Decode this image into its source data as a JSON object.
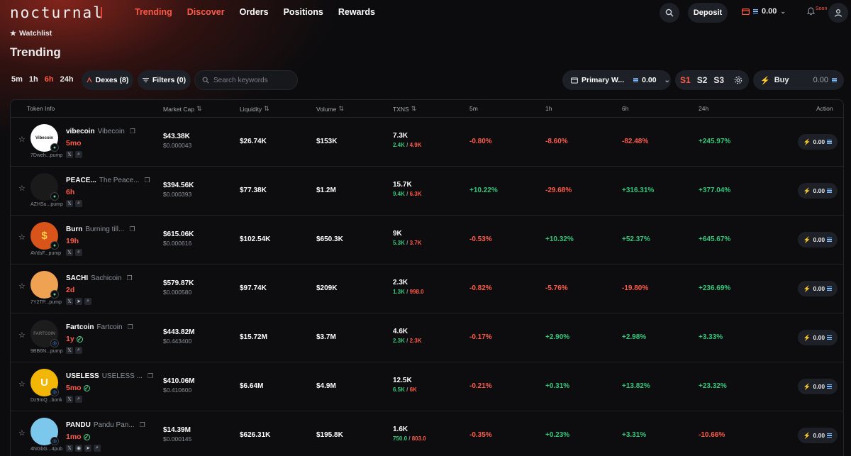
{
  "brand": {
    "logo": "nocturnal"
  },
  "nav": {
    "items": [
      "Trending",
      "Discover",
      "Orders",
      "Positions",
      "Rewards"
    ],
    "active": "Trending"
  },
  "header": {
    "deposit_label": "Deposit",
    "balance": "0.00",
    "soon_badge": "Soon"
  },
  "watchlist_label": "Watchlist",
  "page_title": "Trending",
  "timeframes": {
    "items": [
      "5m",
      "1h",
      "6h",
      "24h"
    ],
    "active": "6h"
  },
  "toolbar": {
    "dexes_label": "Dexes (8)",
    "filters_label": "Filters (0)",
    "search_placeholder": "Search keywords",
    "wallet_label": "Primary W...",
    "wallet_balance": "0.00",
    "presets": [
      "S1",
      "S2",
      "S3"
    ],
    "active_preset": "S1",
    "buy_label": "Buy",
    "buy_amount": "0.00"
  },
  "table": {
    "columns": {
      "token": "Token Info",
      "mcap": "Market Cap",
      "liq": "Liquidity",
      "vol": "Volume",
      "txns": "TXNS",
      "p5m": "5m",
      "p1h": "1h",
      "p6h": "6h",
      "p24h": "24h",
      "action": "Action"
    },
    "rows": [
      {
        "symbol": "vibecoin",
        "name": "Vibecoin",
        "age": "5mo",
        "address": "7Dweh...pump",
        "verified": false,
        "socials": [
          "x-icon",
          "search-icon"
        ],
        "avatar_text": "Vibecoin",
        "avatar_color": "#ffffff",
        "avatar_fg": "#111111",
        "mcap": "$43.38K",
        "price": "$0.000043",
        "liq": "$26.74K",
        "vol": "$153K",
        "txns": "7.3K",
        "buys": "2.4K",
        "sells": "4.9K",
        "p5m": "-0.80%",
        "p1h": "-8.60%",
        "p6h": "-82.48%",
        "p24h": "+245.97%",
        "quick_buy": "0.00"
      },
      {
        "symbol": "PEACE...",
        "name": "The Peace...",
        "age": "6h",
        "address": "AZHSu...pump",
        "verified": false,
        "socials": [
          "x-icon",
          "search-icon"
        ],
        "avatar_text": "",
        "avatar_color": "#1a1a1a",
        "avatar_fg": "#ffffff",
        "mcap": "$394.56K",
        "price": "$0.000393",
        "liq": "$77.38K",
        "vol": "$1.2M",
        "txns": "15.7K",
        "buys": "9.4K",
        "sells": "6.3K",
        "p5m": "+10.22%",
        "p1h": "-29.68%",
        "p6h": "+316.31%",
        "p24h": "+377.04%",
        "quick_buy": "0.00"
      },
      {
        "symbol": "Burn",
        "name": "Burning till...",
        "age": "19h",
        "address": "AVdsF...pump",
        "verified": false,
        "socials": [
          "x-icon",
          "search-icon"
        ],
        "avatar_text": "$",
        "avatar_color": "#d9541a",
        "avatar_fg": "#ffd24a",
        "mcap": "$615.06K",
        "price": "$0.000616",
        "liq": "$102.54K",
        "vol": "$650.3K",
        "txns": "9K",
        "buys": "5.3K",
        "sells": "3.7K",
        "p5m": "-0.53%",
        "p1h": "+10.32%",
        "p6h": "+52.37%",
        "p24h": "+645.67%",
        "quick_buy": "0.00"
      },
      {
        "symbol": "SACHI",
        "name": "Sachicoin",
        "age": "2d",
        "address": "7Y2TP...pump",
        "verified": false,
        "socials": [
          "x-icon",
          "telegram-icon",
          "search-icon"
        ],
        "avatar_text": "",
        "avatar_color": "#f0a253",
        "avatar_fg": "#ffffff",
        "mcap": "$579.87K",
        "price": "$0.000580",
        "liq": "$97.74K",
        "vol": "$209K",
        "txns": "2.3K",
        "buys": "1.3K",
        "sells": "998.0",
        "p5m": "-0.82%",
        "p1h": "-5.76%",
        "p6h": "-19.80%",
        "p24h": "+236.69%",
        "quick_buy": "0.00"
      },
      {
        "symbol": "Fartcoin",
        "name": "Fartcoin",
        "age": "1y",
        "address": "9BB6N...pump",
        "verified": true,
        "socials": [
          "x-icon",
          "search-icon"
        ],
        "avatar_text": "FARTCOIN",
        "avatar_color": "#1c1c1c",
        "avatar_fg": "#666666",
        "mcap": "$443.82M",
        "price": "$0.443400",
        "liq": "$15.72M",
        "vol": "$3.7M",
        "txns": "4.6K",
        "buys": "2.3K",
        "sells": "2.3K",
        "p5m": "-0.17%",
        "p1h": "+2.90%",
        "p6h": "+2.98%",
        "p24h": "+3.33%",
        "quick_buy": "0.00"
      },
      {
        "symbol": "USELESS",
        "name": "USELESS ...",
        "age": "5mo",
        "address": "Dz9mQ...bonk",
        "verified": true,
        "socials": [
          "x-icon",
          "search-icon"
        ],
        "avatar_text": "U",
        "avatar_color": "#f2b705",
        "avatar_fg": "#ffffff",
        "mcap": "$410.06M",
        "price": "$0.410600",
        "liq": "$6.64M",
        "vol": "$4.9M",
        "txns": "12.5K",
        "buys": "6.5K",
        "sells": "6K",
        "p5m": "-0.21%",
        "p1h": "+0.31%",
        "p6h": "+13.82%",
        "p24h": "+23.32%",
        "quick_buy": "0.00"
      },
      {
        "symbol": "PANDU",
        "name": "Pandu Pan...",
        "age": "1mo",
        "address": "4NGbG...4pub",
        "verified": true,
        "socials": [
          "x-icon",
          "web-icon",
          "telegram-icon",
          "search-icon"
        ],
        "avatar_text": "",
        "avatar_color": "#7cc7ec",
        "avatar_fg": "#111111",
        "mcap": "$14.39M",
        "price": "$0.000145",
        "liq": "$626.31K",
        "vol": "$195.8K",
        "txns": "1.6K",
        "buys": "750.0",
        "sells": "803.0",
        "p5m": "-0.35%",
        "p1h": "+0.23%",
        "p6h": "+3.31%",
        "p24h": "-10.66%",
        "quick_buy": "0.00"
      }
    ]
  },
  "colors": {
    "accent": "#ff5a48",
    "positive": "#34c77b",
    "negative": "#ff5a48",
    "panel": "#1d2026",
    "background": "#0c0c0e"
  }
}
